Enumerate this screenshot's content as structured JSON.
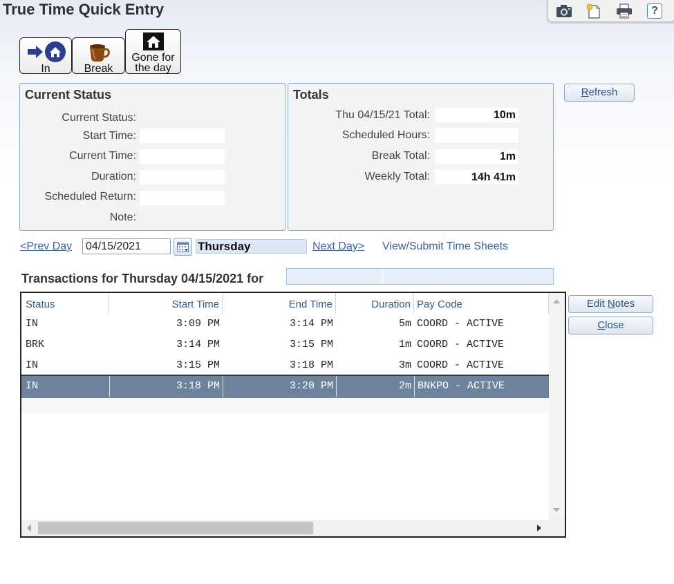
{
  "app": {
    "title": "True Time Quick Entry"
  },
  "toolbar": {
    "icons": [
      "camera-icon",
      "new-note-icon",
      "print-icon",
      "help-icon"
    ],
    "help_glyph": "?"
  },
  "actions": {
    "in_label": "In",
    "break_label": "Break",
    "gone_line1": "Gone for",
    "gone_line2": "the day"
  },
  "current_status": {
    "title": "Current Status",
    "labels": {
      "status": "Current Status:",
      "start": "Start Time:",
      "current": "Current Time:",
      "duration": "Duration:",
      "return": "Scheduled Return:",
      "note": "Note:"
    },
    "values": {
      "status": "",
      "start": "",
      "current": "",
      "duration": "",
      "return": "",
      "note": ""
    }
  },
  "totals": {
    "title": "Totals",
    "labels": {
      "day": "Thu 04/15/21 Total:",
      "scheduled": "Scheduled Hours:",
      "break": "Break Total:",
      "weekly": "Weekly Total:"
    },
    "values": {
      "day": "10m",
      "scheduled": "",
      "break": "1m",
      "weekly": "14h 41m"
    }
  },
  "refresh": {
    "label_first": "R",
    "label_rest": "efresh"
  },
  "nav": {
    "prev": "<Prev Day",
    "date": "04/15/2021",
    "weekday": "Thursday",
    "next": "Next Day>",
    "view_submit": "View/Submit Time Sheets"
  },
  "transactions": {
    "heading": "Transactions for Thursday 04/15/2021 for",
    "columns": [
      "Status",
      "Start Time",
      "End Time",
      "Duration",
      "Pay Code"
    ],
    "rows": [
      {
        "status": "IN",
        "start": "3:09 PM",
        "end": "3:14 PM",
        "duration": "5m",
        "pay_code": "COORD - ACTIVE"
      },
      {
        "status": "BRK",
        "start": "3:14 PM",
        "end": "3:15 PM",
        "duration": "1m",
        "pay_code": "COORD - ACTIVE"
      },
      {
        "status": "IN",
        "start": "3:15 PM",
        "end": "3:18 PM",
        "duration": "3m",
        "pay_code": "COORD - ACTIVE"
      },
      {
        "status": "IN",
        "start": "3:18 PM",
        "end": "3:20 PM",
        "duration": "2m",
        "pay_code": "BNKPO - ACTIVE"
      }
    ],
    "selected_row": 3
  },
  "side_buttons": {
    "edit_notes_a": "Edit ",
    "edit_notes_u": "N",
    "edit_notes_b": "otes",
    "close_u": "C",
    "close_rest": "lose"
  },
  "colors": {
    "accent": "#3a62a6",
    "selected_row": "#6d839c",
    "panel_border": "#8ea7c8"
  }
}
